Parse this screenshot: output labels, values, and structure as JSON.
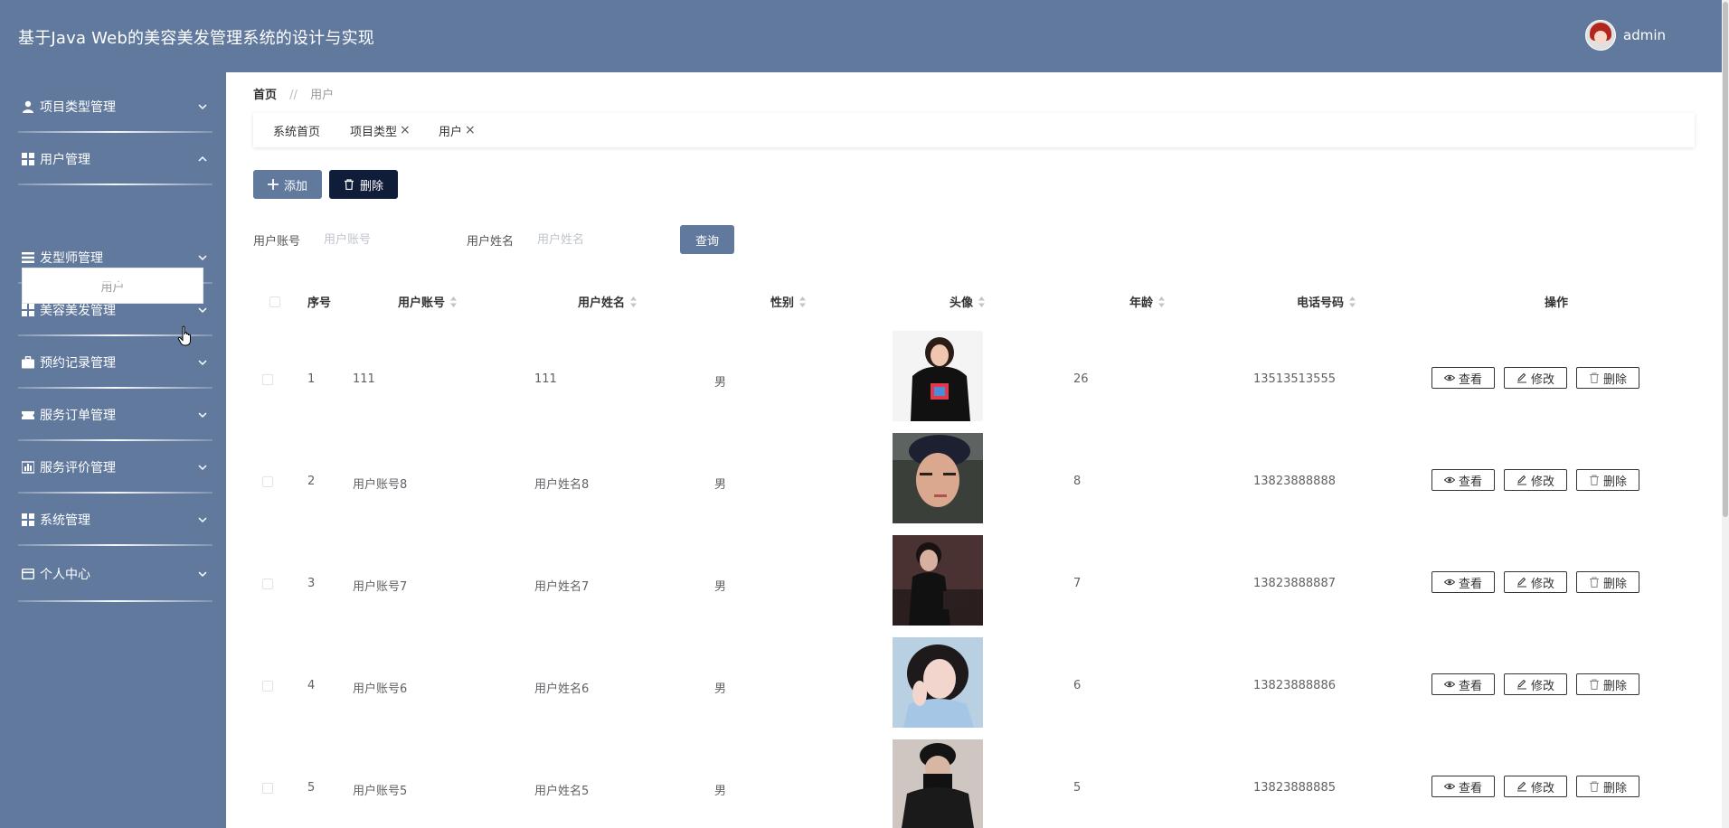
{
  "app": {
    "title": "基于Java Web的美容美发管理系统的设计与实现",
    "username": "admin"
  },
  "sidebar": {
    "items": [
      {
        "label": "项目类型管理",
        "icon": "user-icon"
      },
      {
        "label": "用户管理",
        "icon": "grid-icon",
        "expanded": true,
        "children": [
          {
            "label": "用户"
          }
        ]
      },
      {
        "label": "发型师管理",
        "icon": "list-icon"
      },
      {
        "label": "美容美发管理",
        "icon": "grid-icon"
      },
      {
        "label": "预约记录管理",
        "icon": "briefcase-icon"
      },
      {
        "label": "服务订单管理",
        "icon": "ticket-icon"
      },
      {
        "label": "服务评价管理",
        "icon": "chart-icon"
      },
      {
        "label": "系统管理",
        "icon": "grid-icon"
      },
      {
        "label": "个人中心",
        "icon": "card-icon"
      }
    ]
  },
  "breadcrumb": {
    "home": "首页",
    "separator": "//",
    "current": "用户"
  },
  "tabs": [
    {
      "label": "系统首页",
      "closable": false
    },
    {
      "label": "项目类型",
      "closable": true
    },
    {
      "label": "用户",
      "closable": true
    }
  ],
  "toolbar": {
    "add_label": "添加",
    "delete_label": "删除"
  },
  "search": {
    "account_label": "用户账号",
    "account_placeholder": "用户账号",
    "name_label": "用户姓名",
    "name_placeholder": "用户姓名",
    "query_label": "查询"
  },
  "table": {
    "columns": [
      "序号",
      "用户账号",
      "用户姓名",
      "性别",
      "头像",
      "年龄",
      "电话号码",
      "操作"
    ],
    "rows": [
      {
        "index": "1",
        "account": "111",
        "name": "111",
        "gender": "男",
        "age": "26",
        "phone": "13513513555"
      },
      {
        "index": "2",
        "account": "用户账号8",
        "name": "用户姓名8",
        "gender": "男",
        "age": "8",
        "phone": "13823888888"
      },
      {
        "index": "3",
        "account": "用户账号7",
        "name": "用户姓名7",
        "gender": "男",
        "age": "7",
        "phone": "13823888887"
      },
      {
        "index": "4",
        "account": "用户账号6",
        "name": "用户姓名6",
        "gender": "男",
        "age": "6",
        "phone": "13823888886"
      },
      {
        "index": "5",
        "account": "用户账号5",
        "name": "用户姓名5",
        "gender": "男",
        "age": "5",
        "phone": "13823888885"
      }
    ],
    "actions": {
      "view": "查看",
      "edit": "修改",
      "delete": "删除"
    }
  },
  "colors": {
    "primary": "#60799d",
    "dark": "#101d38",
    "header_bg": "#60799d"
  }
}
